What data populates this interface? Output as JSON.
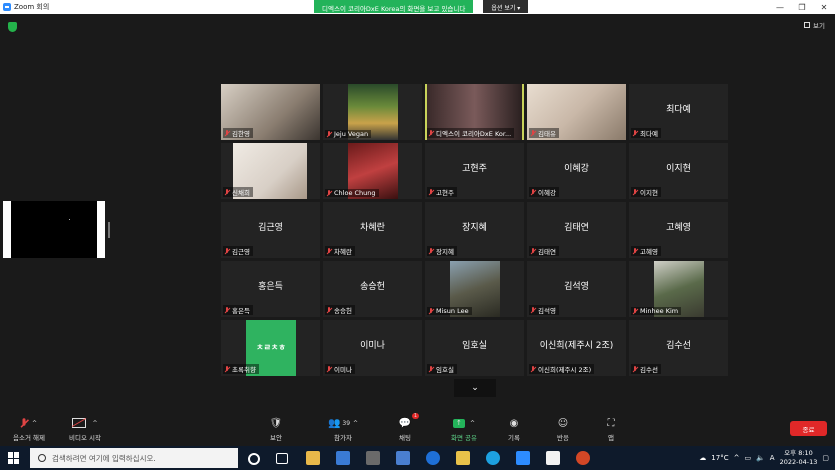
{
  "window": {
    "title": "Zoom 회의"
  },
  "share_banner": {
    "message": "디엑스이 코리아DxE Korea의 화면을 보고 있습니다",
    "options_label": "옵션 보기"
  },
  "view_button": {
    "label": "보기"
  },
  "participants": [
    {
      "name": "김한영",
      "big": "",
      "video": true
    },
    {
      "name": "Jeju Vegan",
      "big": "",
      "video": true
    },
    {
      "name": "디엑스이 코리아DxE Kor...",
      "big": "",
      "video": true,
      "speaking": true
    },
    {
      "name": "김태유",
      "big": "",
      "video": true
    },
    {
      "name": "최다예",
      "big": "최다예",
      "video": false
    },
    {
      "name": "신채희",
      "big": "",
      "video": true
    },
    {
      "name": "Chloe Chung",
      "big": "",
      "video": true
    },
    {
      "name": "고현주",
      "big": "고현주",
      "video": false
    },
    {
      "name": "이혜강",
      "big": "이혜강",
      "video": false
    },
    {
      "name": "이지현",
      "big": "이지현",
      "video": false
    },
    {
      "name": "김근영",
      "big": "김근영",
      "video": false
    },
    {
      "name": "차혜란",
      "big": "차혜란",
      "video": false
    },
    {
      "name": "장지혜",
      "big": "장지혜",
      "video": false
    },
    {
      "name": "김태연",
      "big": "김태연",
      "video": false
    },
    {
      "name": "고혜영",
      "big": "고혜영",
      "video": false
    },
    {
      "name": "홍은득",
      "big": "홍은득",
      "video": false
    },
    {
      "name": "송승헌",
      "big": "송승헌",
      "video": false
    },
    {
      "name": "Misun Lee",
      "big": "",
      "video": true
    },
    {
      "name": "김석영",
      "big": "김석영",
      "video": false
    },
    {
      "name": "Minhee Kim",
      "big": "",
      "video": true
    },
    {
      "name": "초록취향",
      "big": "",
      "video": true
    },
    {
      "name": "이미나",
      "big": "이미나",
      "video": false
    },
    {
      "name": "임호실",
      "big": "임호실",
      "video": false
    },
    {
      "name": "이신희(제주시 2조)",
      "big": "이신희(제주시 2조)",
      "video": false
    },
    {
      "name": "김수선",
      "big": "김수선",
      "video": false
    }
  ],
  "toolbar": {
    "unmute": "음소거 해제",
    "start_video": "비디오 시작",
    "security": "보안",
    "participants": "참가자",
    "participants_count": "39",
    "chat": "채팅",
    "chat_badge": "1",
    "share_screen": "화면 공유",
    "record": "기록",
    "reactions": "반응",
    "apps": "앱",
    "end": "종료"
  },
  "taskbar": {
    "search_placeholder": "검색하려면 여기에 입력하십시오.",
    "weather": "17°C",
    "ime": "A",
    "time": "오후 8:10",
    "date": "2022-04-13"
  },
  "colors": {
    "accent_green": "#23b35a",
    "end_red": "#e02828",
    "speaker_outline": "#c8d35a",
    "zoom_blue": "#2d8cff"
  }
}
